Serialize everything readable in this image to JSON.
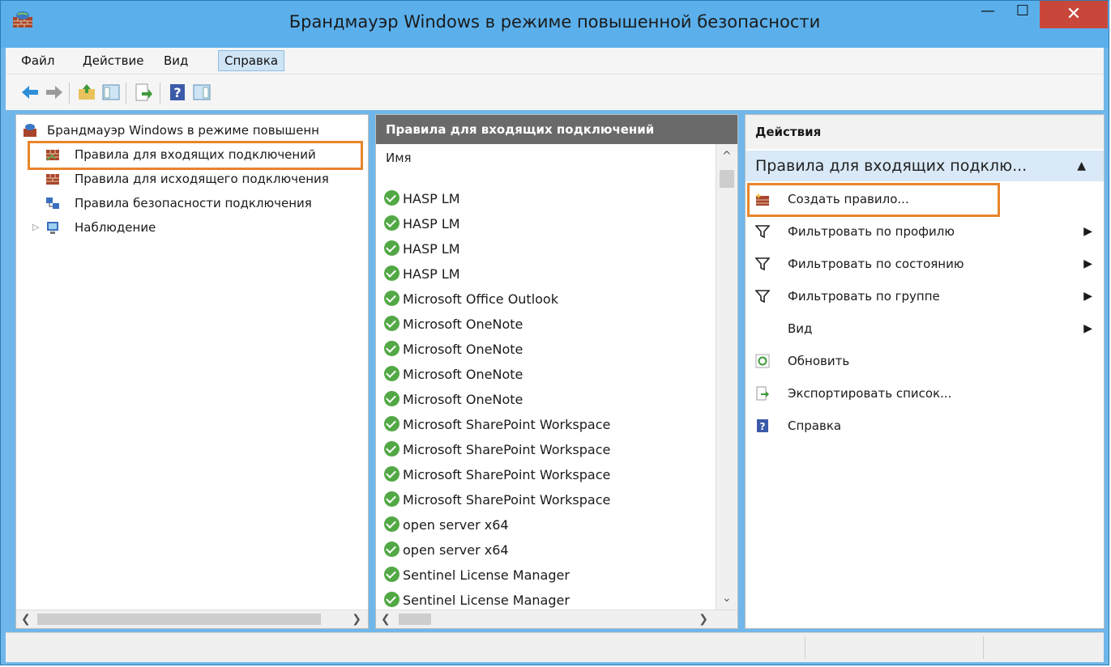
{
  "window": {
    "title": "Брандмауэр Windows в режиме повышенной безопасности"
  },
  "menu": [
    "Файл",
    "Действие",
    "Вид",
    "Справка"
  ],
  "tree": {
    "root": "Брандмауэр Windows в режиме повышенн",
    "items": [
      "Правила для входящих подключений",
      "Правила для исходящего подключения",
      "Правила безопасности подключения",
      "Наблюдение"
    ]
  },
  "rules": {
    "header": "Правила для входящих подключений",
    "column": "Имя",
    "items": [
      "HASP LM",
      "HASP LM",
      "HASP LM",
      "HASP LM",
      "Microsoft Office Outlook",
      "Microsoft OneNote",
      "Microsoft OneNote",
      "Microsoft OneNote",
      "Microsoft OneNote",
      "Microsoft SharePoint Workspace",
      "Microsoft SharePoint Workspace",
      "Microsoft SharePoint Workspace",
      "Microsoft SharePoint Workspace",
      "open server x64",
      "open server x64",
      "Sentinel License Manager",
      "Sentinel License Manager"
    ]
  },
  "actions": {
    "header": "Действия",
    "section": "Правила для входящих подклю...",
    "items": [
      "Создать правило...",
      "Фильтровать по профилю",
      "Фильтровать по состоянию",
      "Фильтровать по группе",
      "Вид",
      "Обновить",
      "Экспортировать список...",
      "Справка"
    ]
  },
  "icons": {
    "back": "back-arrow-icon",
    "forward": "forward-arrow-icon",
    "help": "help-icon",
    "filter": "filter-icon",
    "refresh": "refresh-icon",
    "export": "export-icon",
    "firewall": "firewall-icon"
  },
  "colors": {
    "titlebar": "#5bb0ec",
    "close": "#c9473a",
    "highlight": "#e8852b",
    "selection": "#d9e9f7",
    "check": "#52a845"
  }
}
